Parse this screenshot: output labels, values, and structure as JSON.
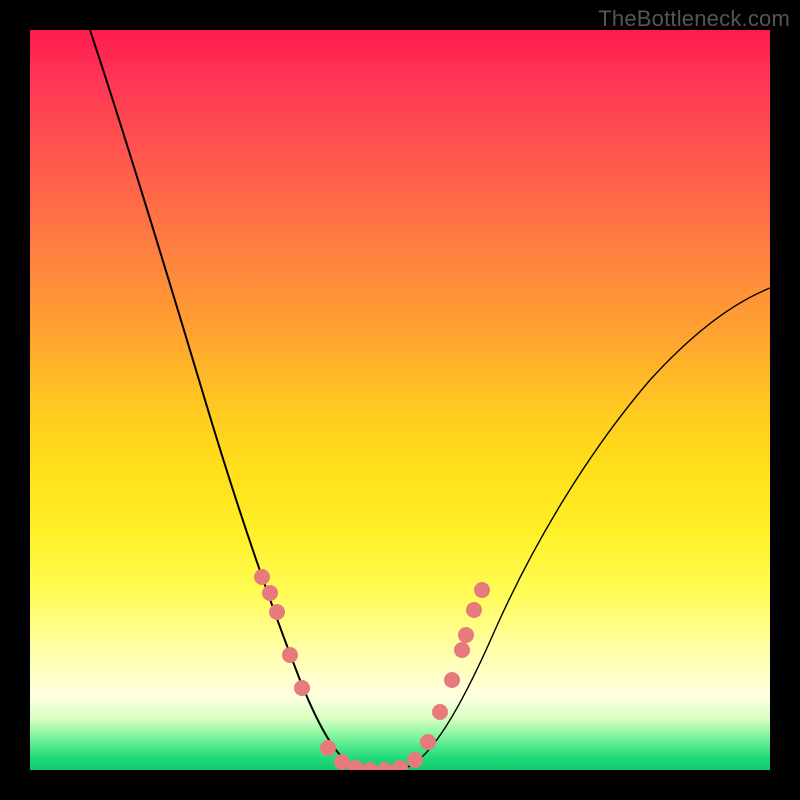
{
  "watermark": "TheBottleneck.com",
  "chart_data": {
    "type": "line",
    "title": "",
    "xlabel": "",
    "ylabel": "",
    "xlim": [
      0,
      100
    ],
    "ylim": [
      0,
      100
    ],
    "grid": false,
    "legend": false,
    "series": [
      {
        "name": "bottleneck-curve",
        "x": [
          8,
          12,
          16,
          20,
          24,
          28,
          31,
          34,
          36,
          38,
          40,
          42,
          44,
          47,
          50,
          53,
          56,
          59,
          62,
          66,
          72,
          80,
          90,
          100
        ],
        "y": [
          100,
          88,
          74,
          60,
          47,
          35,
          26,
          18,
          12,
          7,
          3,
          1,
          0,
          0,
          1,
          3,
          7,
          12,
          18,
          26,
          36,
          48,
          58,
          65
        ]
      }
    ],
    "markers": {
      "name": "highlighted-points",
      "x": [
        31,
        32,
        33,
        35,
        36.5,
        40,
        42,
        44,
        46,
        48,
        50,
        52,
        53.5,
        55,
        56.5,
        58
      ],
      "y": [
        26,
        24,
        21,
        15,
        11,
        3,
        1,
        0,
        0,
        0,
        1,
        2.5,
        5,
        9,
        13,
        17
      ]
    },
    "background_gradient": {
      "top_color": "#ff1a4d",
      "mid_color": "#ffe11a",
      "bottom_color": "#14c76f"
    }
  }
}
